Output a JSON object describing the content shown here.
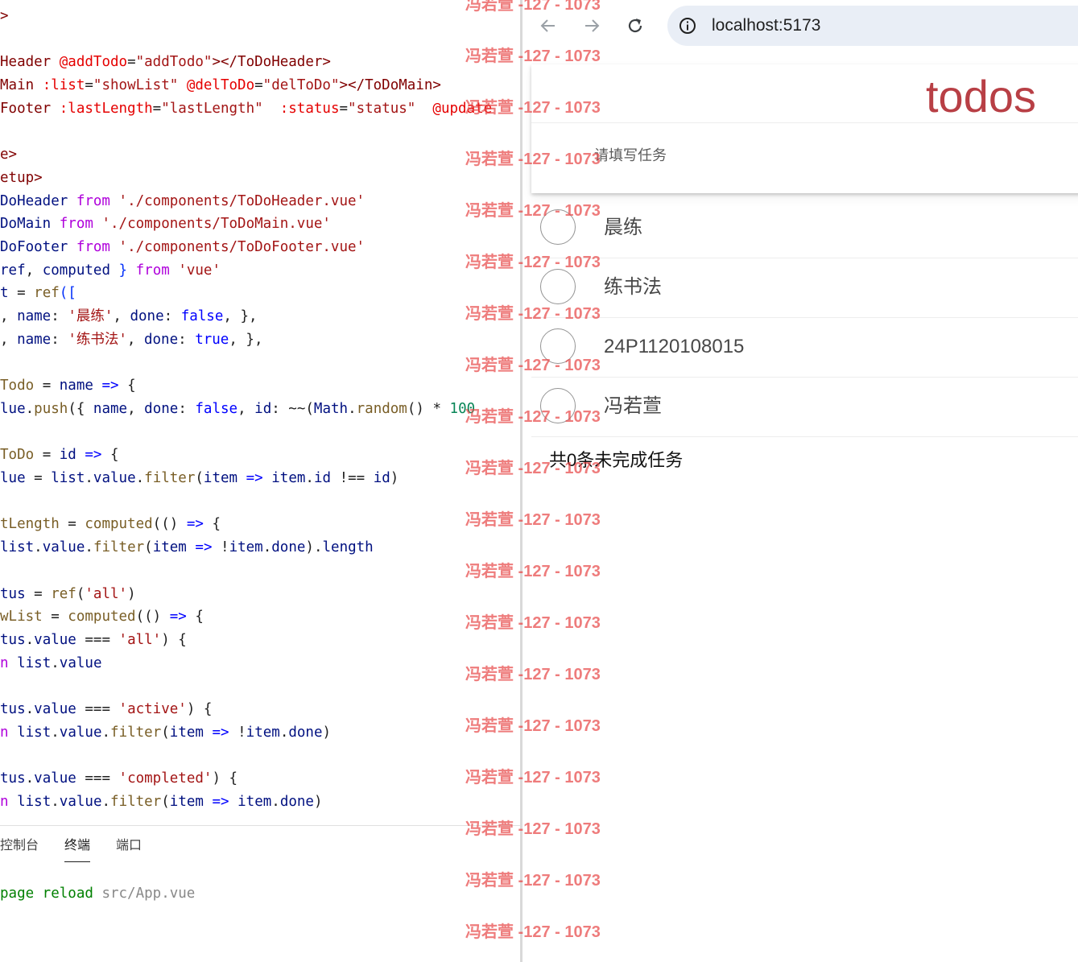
{
  "editor": {
    "lines": [
      [
        [
          "tk-tag",
          ">"
        ]
      ],
      [],
      [
        [
          "tk-tag",
          "Header "
        ],
        [
          "tk-attr",
          "@addTodo"
        ],
        [
          "tk-plain",
          "="
        ],
        [
          "tk-string",
          "\"addTodo\""
        ],
        [
          "tk-tag",
          "></ToDoHeader>"
        ]
      ],
      [
        [
          "tk-tag",
          "Main "
        ],
        [
          "tk-attr",
          ":list"
        ],
        [
          "tk-plain",
          "="
        ],
        [
          "tk-string",
          "\"showList\""
        ],
        [
          "tk-plain",
          " "
        ],
        [
          "tk-attr",
          "@delToDo"
        ],
        [
          "tk-plain",
          "="
        ],
        [
          "tk-string",
          "\"delToDo\""
        ],
        [
          "tk-tag",
          "></ToDoMain>"
        ]
      ],
      [
        [
          "tk-tag",
          "Footer "
        ],
        [
          "tk-attr",
          ":lastLength"
        ],
        [
          "tk-plain",
          "="
        ],
        [
          "tk-string",
          "\"lastLength\""
        ],
        [
          "tk-plain",
          "  "
        ],
        [
          "tk-attr",
          ":status"
        ],
        [
          "tk-plain",
          "="
        ],
        [
          "tk-string",
          "\"status\""
        ],
        [
          "tk-plain",
          "  "
        ],
        [
          "tk-attr",
          "@update"
        ]
      ],
      [],
      [
        [
          "tk-tag",
          "e>"
        ]
      ],
      [
        [
          "tk-tag",
          "etup>"
        ]
      ],
      [
        [
          "tk-var",
          "DoHeader "
        ],
        [
          "tk-import",
          "from"
        ],
        [
          "tk-plain",
          " "
        ],
        [
          "tk-string",
          "'./components/ToDoHeader.vue'"
        ]
      ],
      [
        [
          "tk-var",
          "DoMain "
        ],
        [
          "tk-import",
          "from"
        ],
        [
          "tk-plain",
          " "
        ],
        [
          "tk-string",
          "'./components/ToDoMain.vue'"
        ]
      ],
      [
        [
          "tk-var",
          "DoFooter "
        ],
        [
          "tk-import",
          "from"
        ],
        [
          "tk-plain",
          " "
        ],
        [
          "tk-string",
          "'./components/ToDoFooter.vue'"
        ]
      ],
      [
        [
          "tk-var",
          "ref"
        ],
        [
          "tk-plain",
          ", "
        ],
        [
          "tk-var",
          "computed"
        ],
        [
          "tk-plain",
          " "
        ],
        [
          "tk-bracket",
          "}"
        ],
        [
          "tk-plain",
          " "
        ],
        [
          "tk-import",
          "from"
        ],
        [
          "tk-plain",
          " "
        ],
        [
          "tk-string",
          "'vue'"
        ]
      ],
      [
        [
          "tk-var",
          "t"
        ],
        [
          "tk-plain",
          " = "
        ],
        [
          "tk-func",
          "ref"
        ],
        [
          "tk-bracket",
          "(["
        ]
      ],
      [
        [
          "tk-plain",
          ", "
        ],
        [
          "tk-var",
          "name"
        ],
        [
          "tk-plain",
          ": "
        ],
        [
          "tk-string",
          "'晨练'"
        ],
        [
          "tk-plain",
          ", "
        ],
        [
          "tk-var",
          "done"
        ],
        [
          "tk-plain",
          ": "
        ],
        [
          "tk-keyword",
          "false"
        ],
        [
          "tk-plain",
          ", },"
        ]
      ],
      [
        [
          "tk-plain",
          ", "
        ],
        [
          "tk-var",
          "name"
        ],
        [
          "tk-plain",
          ": "
        ],
        [
          "tk-string",
          "'练书法'"
        ],
        [
          "tk-plain",
          ", "
        ],
        [
          "tk-var",
          "done"
        ],
        [
          "tk-plain",
          ": "
        ],
        [
          "tk-keyword",
          "true"
        ],
        [
          "tk-plain",
          ", },"
        ]
      ],
      [],
      [
        [
          "tk-func",
          "Todo"
        ],
        [
          "tk-plain",
          " = "
        ],
        [
          "tk-var",
          "name"
        ],
        [
          "tk-plain",
          " "
        ],
        [
          "tk-keyword",
          "=>"
        ],
        [
          "tk-plain",
          " {"
        ]
      ],
      [
        [
          "tk-var",
          "lue"
        ],
        [
          "tk-plain",
          "."
        ],
        [
          "tk-func",
          "push"
        ],
        [
          "tk-plain",
          "({ "
        ],
        [
          "tk-var",
          "name"
        ],
        [
          "tk-plain",
          ", "
        ],
        [
          "tk-var",
          "done"
        ],
        [
          "tk-plain",
          ": "
        ],
        [
          "tk-keyword",
          "false"
        ],
        [
          "tk-plain",
          ", "
        ],
        [
          "tk-var",
          "id"
        ],
        [
          "tk-plain",
          ": ~~("
        ],
        [
          "tk-var",
          "Math"
        ],
        [
          "tk-plain",
          "."
        ],
        [
          "tk-func",
          "random"
        ],
        [
          "tk-plain",
          "() * "
        ],
        [
          "tk-num",
          "100"
        ]
      ],
      [],
      [
        [
          "tk-func",
          "ToDo"
        ],
        [
          "tk-plain",
          " = "
        ],
        [
          "tk-var",
          "id"
        ],
        [
          "tk-plain",
          " "
        ],
        [
          "tk-keyword",
          "=>"
        ],
        [
          "tk-plain",
          " {"
        ]
      ],
      [
        [
          "tk-var",
          "lue"
        ],
        [
          "tk-plain",
          " = "
        ],
        [
          "tk-var",
          "list"
        ],
        [
          "tk-plain",
          "."
        ],
        [
          "tk-var",
          "value"
        ],
        [
          "tk-plain",
          "."
        ],
        [
          "tk-func",
          "filter"
        ],
        [
          "tk-plain",
          "("
        ],
        [
          "tk-var",
          "item"
        ],
        [
          "tk-plain",
          " "
        ],
        [
          "tk-keyword",
          "=>"
        ],
        [
          "tk-plain",
          " "
        ],
        [
          "tk-var",
          "item"
        ],
        [
          "tk-plain",
          "."
        ],
        [
          "tk-var",
          "id"
        ],
        [
          "tk-plain",
          " !== "
        ],
        [
          "tk-var",
          "id"
        ],
        [
          "tk-plain",
          ")"
        ]
      ],
      [],
      [
        [
          "tk-func",
          "tLength"
        ],
        [
          "tk-plain",
          " = "
        ],
        [
          "tk-func",
          "computed"
        ],
        [
          "tk-plain",
          "(() "
        ],
        [
          "tk-keyword",
          "=>"
        ],
        [
          "tk-plain",
          " {"
        ]
      ],
      [
        [
          "tk-var",
          "list"
        ],
        [
          "tk-plain",
          "."
        ],
        [
          "tk-var",
          "value"
        ],
        [
          "tk-plain",
          "."
        ],
        [
          "tk-func",
          "filter"
        ],
        [
          "tk-plain",
          "("
        ],
        [
          "tk-var",
          "item"
        ],
        [
          "tk-plain",
          " "
        ],
        [
          "tk-keyword",
          "=>"
        ],
        [
          "tk-plain",
          " !"
        ],
        [
          "tk-var",
          "item"
        ],
        [
          "tk-plain",
          "."
        ],
        [
          "tk-var",
          "done"
        ],
        [
          "tk-plain",
          ")."
        ],
        [
          "tk-var",
          "length"
        ]
      ],
      [],
      [
        [
          "tk-var",
          "tus"
        ],
        [
          "tk-plain",
          " = "
        ],
        [
          "tk-func",
          "ref"
        ],
        [
          "tk-plain",
          "("
        ],
        [
          "tk-string",
          "'all'"
        ],
        [
          "tk-plain",
          ")"
        ]
      ],
      [
        [
          "tk-func",
          "wList"
        ],
        [
          "tk-plain",
          " = "
        ],
        [
          "tk-func",
          "computed"
        ],
        [
          "tk-plain",
          "(() "
        ],
        [
          "tk-keyword",
          "=>"
        ],
        [
          "tk-plain",
          " {"
        ]
      ],
      [
        [
          "tk-var",
          "tus"
        ],
        [
          "tk-plain",
          "."
        ],
        [
          "tk-var",
          "value"
        ],
        [
          "tk-plain",
          " === "
        ],
        [
          "tk-string",
          "'all'"
        ],
        [
          "tk-plain",
          ") {"
        ]
      ],
      [
        [
          "tk-import",
          "n"
        ],
        [
          "tk-plain",
          " "
        ],
        [
          "tk-var",
          "list"
        ],
        [
          "tk-plain",
          "."
        ],
        [
          "tk-var",
          "value"
        ]
      ],
      [],
      [
        [
          "tk-var",
          "tus"
        ],
        [
          "tk-plain",
          "."
        ],
        [
          "tk-var",
          "value"
        ],
        [
          "tk-plain",
          " === "
        ],
        [
          "tk-string",
          "'active'"
        ],
        [
          "tk-plain",
          ") {"
        ]
      ],
      [
        [
          "tk-import",
          "n"
        ],
        [
          "tk-plain",
          " "
        ],
        [
          "tk-var",
          "list"
        ],
        [
          "tk-plain",
          "."
        ],
        [
          "tk-var",
          "value"
        ],
        [
          "tk-plain",
          "."
        ],
        [
          "tk-func",
          "filter"
        ],
        [
          "tk-plain",
          "("
        ],
        [
          "tk-var",
          "item"
        ],
        [
          "tk-plain",
          " "
        ],
        [
          "tk-keyword",
          "=>"
        ],
        [
          "tk-plain",
          " !"
        ],
        [
          "tk-var",
          "item"
        ],
        [
          "tk-plain",
          "."
        ],
        [
          "tk-var",
          "done"
        ],
        [
          "tk-plain",
          ")"
        ]
      ],
      [],
      [
        [
          "tk-var",
          "tus"
        ],
        [
          "tk-plain",
          "."
        ],
        [
          "tk-var",
          "value"
        ],
        [
          "tk-plain",
          " === "
        ],
        [
          "tk-string",
          "'completed'"
        ],
        [
          "tk-plain",
          ") {"
        ]
      ],
      [
        [
          "tk-import",
          "n"
        ],
        [
          "tk-plain",
          " "
        ],
        [
          "tk-var",
          "list"
        ],
        [
          "tk-plain",
          "."
        ],
        [
          "tk-var",
          "value"
        ],
        [
          "tk-plain",
          "."
        ],
        [
          "tk-func",
          "filter"
        ],
        [
          "tk-plain",
          "("
        ],
        [
          "tk-var",
          "item"
        ],
        [
          "tk-plain",
          " "
        ],
        [
          "tk-keyword",
          "=>"
        ],
        [
          "tk-plain",
          " "
        ],
        [
          "tk-var",
          "item"
        ],
        [
          "tk-plain",
          "."
        ],
        [
          "tk-var",
          "done"
        ],
        [
          "tk-plain",
          ")"
        ]
      ]
    ]
  },
  "panel": {
    "tabs": [
      {
        "label": "控制台",
        "active": false
      },
      {
        "label": "终端",
        "active": true
      },
      {
        "label": "端口",
        "active": false
      }
    ],
    "terminal": {
      "keyword": "page reload",
      "path": " src/App.vue"
    }
  },
  "browser": {
    "url": "localhost:5173",
    "icons": {
      "back": "back-arrow-icon",
      "forward": "forward-arrow-icon",
      "reload": "reload-icon",
      "info": "info-icon"
    }
  },
  "todo": {
    "title": "todos",
    "placeholder": "请填写任务",
    "items": [
      {
        "label": "晨练",
        "done": false
      },
      {
        "label": "练书法",
        "done": false
      },
      {
        "label": "24P1120108015",
        "done": false
      },
      {
        "label": "冯若萱",
        "done": false
      }
    ],
    "footer": "共0条未完成任务"
  },
  "watermark": {
    "text": "冯若萱 -127 - 1073",
    "color": "#e84646"
  }
}
